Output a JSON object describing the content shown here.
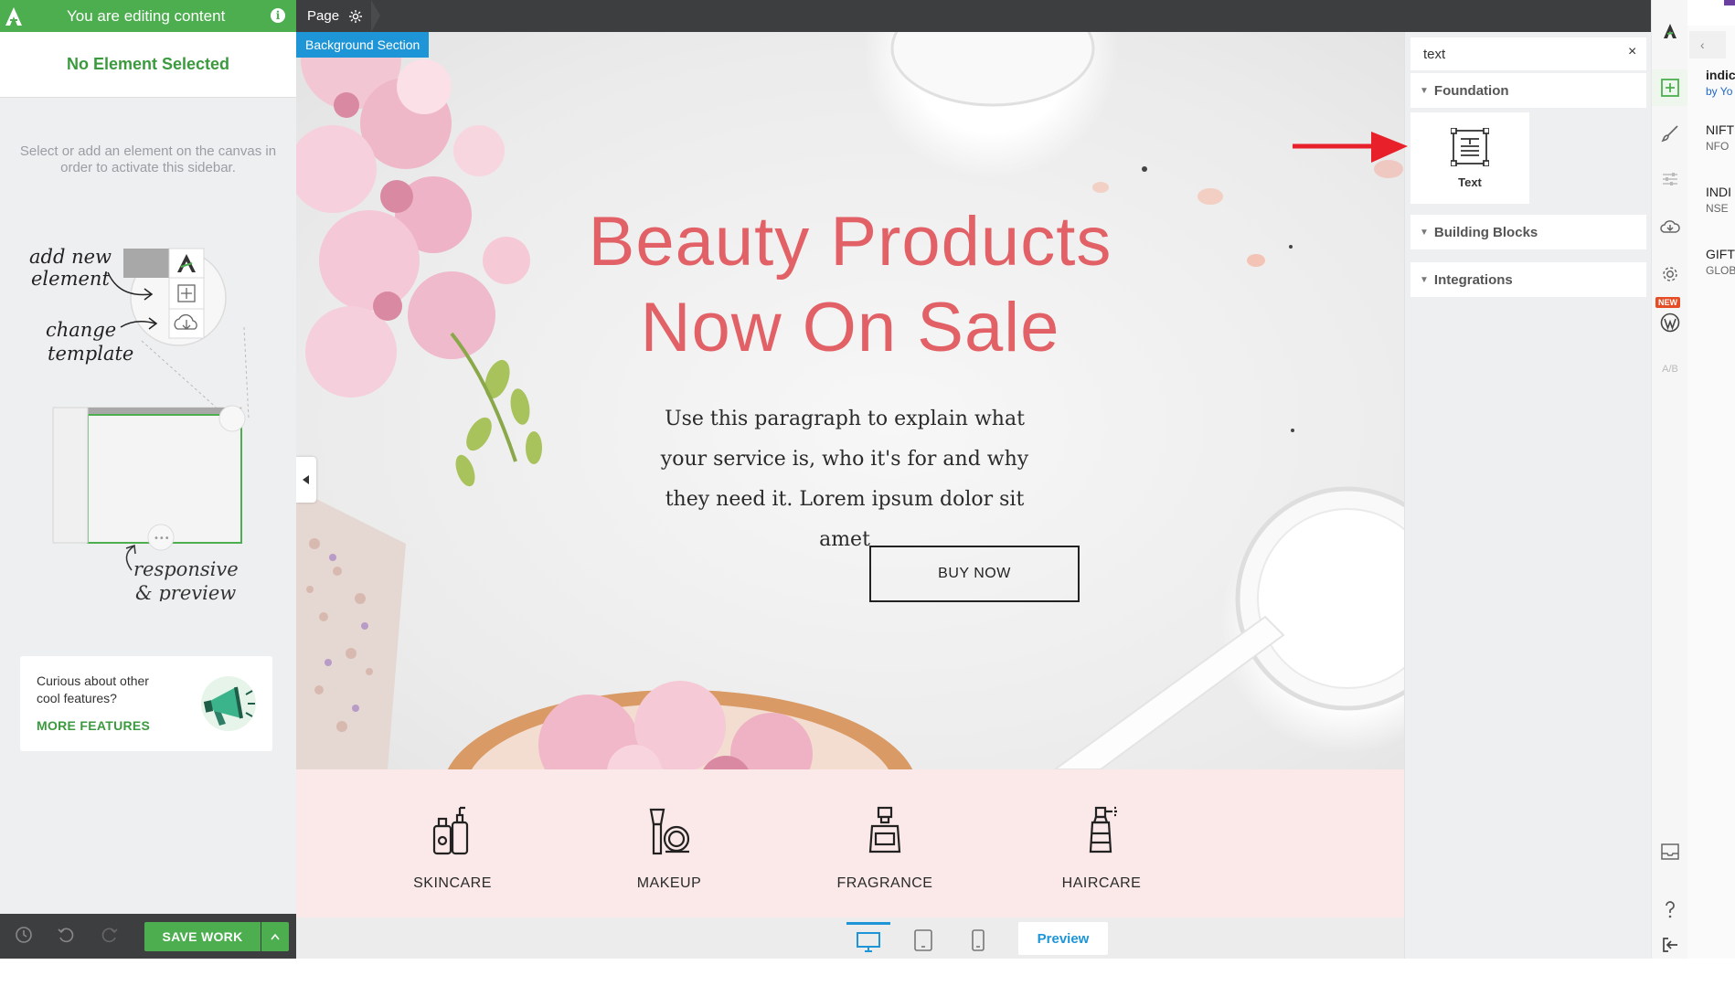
{
  "editor": {
    "banner_text": "You are editing content",
    "info_glyph": "i",
    "no_element": "No Element Selected",
    "hint": "Select or add an element on the canvas in order to activate this sidebar.",
    "illustration": {
      "add_new_element": "add new\nelement",
      "change_template": "change\ntemplate",
      "responsive_preview": "responsive\n& preview"
    },
    "features": {
      "question": "Curious about other cool features?",
      "link": "MORE FEATURES"
    },
    "bottom": {
      "save_label": "SAVE WORK",
      "caret": "^"
    }
  },
  "topbar": {
    "page_label": "Page"
  },
  "canvas": {
    "section_label": "Background Section",
    "headline_1": "Beauty Products",
    "headline_2": "Now On Sale",
    "paragraph": "Use this paragraph to explain what your service is, who it's for and why they need it. Lorem ipsum dolor sit amet",
    "button_label": "BUY NOW",
    "categories": [
      {
        "label": "SKINCARE",
        "icon": "skincare-bottles-icon"
      },
      {
        "label": "MAKEUP",
        "icon": "makeup-brush-compact-icon"
      },
      {
        "label": "FRAGRANCE",
        "icon": "perfume-bottle-icon"
      },
      {
        "label": "HAIRCARE",
        "icon": "spray-bottle-icon"
      }
    ],
    "views": {
      "preview_label": "Preview"
    }
  },
  "element_panel": {
    "search_value": "text",
    "clear_glyph": "×",
    "groups": [
      {
        "label": "Foundation"
      },
      {
        "label": "Building Blocks"
      },
      {
        "label": "Integrations"
      }
    ],
    "element_tile_label": "Text"
  },
  "rail": {
    "new_badge": "NEW",
    "ab_label": "A/B"
  },
  "far_right": {
    "back_glyph": "‹",
    "items": [
      {
        "title": "indic",
        "sub": "by Yo"
      },
      {
        "title": "NIFT",
        "sub": "NFO"
      },
      {
        "title": "INDI",
        "sub": "NSE"
      },
      {
        "title": "GIFT",
        "sub": "GLOB"
      }
    ]
  },
  "colors": {
    "brand_green": "#4cae4f",
    "accent_blue": "#1d95d6",
    "headline_coral": "#e26166",
    "category_band": "#fbe8e8",
    "dark_bar": "#3d3e40"
  }
}
